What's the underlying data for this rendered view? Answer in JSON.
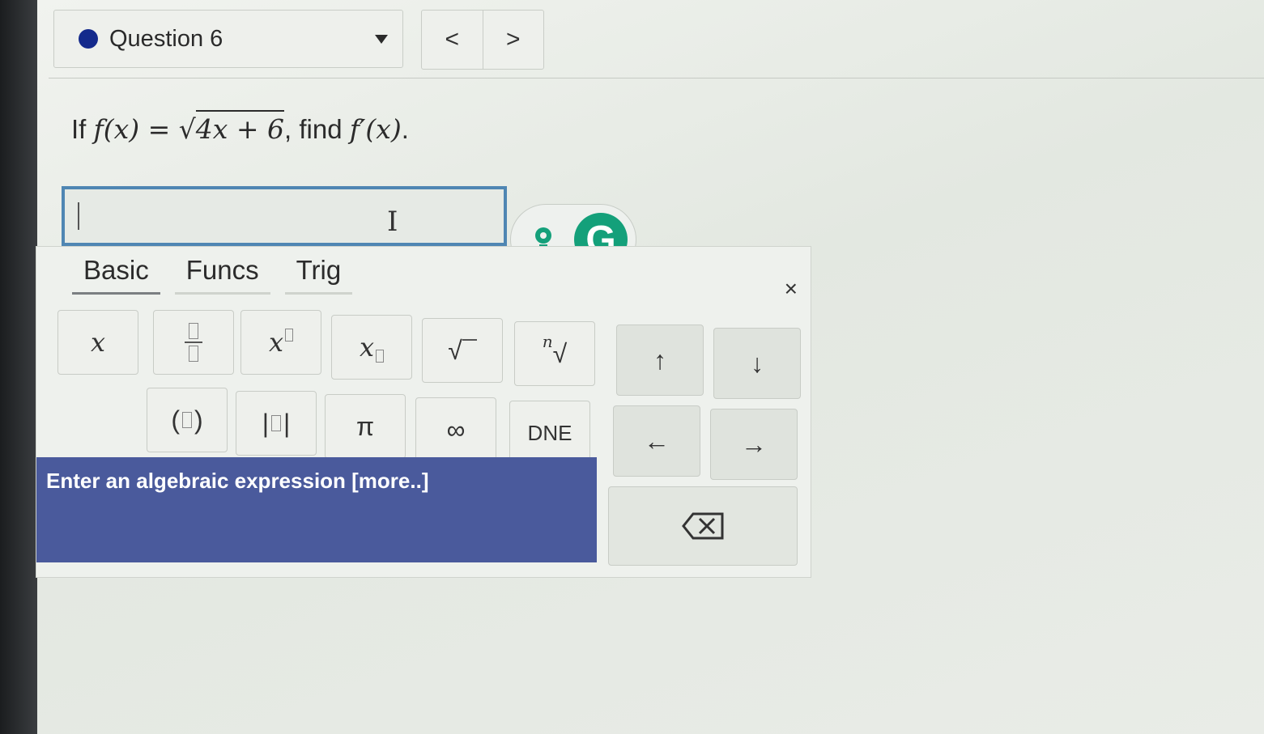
{
  "question": {
    "label": "Question 6",
    "prev": "<",
    "next": ">"
  },
  "prompt": {
    "prefix": "If",
    "func": "f(x) = ",
    "radicand": "4x + 6",
    "middle": ", find",
    "target": "f′(x)",
    "suffix": "."
  },
  "answer": {
    "value": ""
  },
  "palette": {
    "tabs": [
      "Basic",
      "Funcs",
      "Trig"
    ],
    "close": "×",
    "keys": {
      "x": "x",
      "frac": "fraction",
      "power": "x",
      "subscript": "x",
      "sqrt": "√",
      "nthroot_n": "n",
      "nthroot": "√",
      "up": "↑",
      "down": "↓",
      "paren_open": "(",
      "paren_close": ")",
      "abs_open": "|",
      "abs_close": "|",
      "pi": "π",
      "infinity": "∞",
      "dne": "DNE",
      "left": "←",
      "right": "→"
    },
    "status": "Enter an algebraic expression [more..]"
  },
  "colors": {
    "accent": "#142a8c",
    "focus_border": "#4f86b3",
    "status_bar": "#4a5a9c",
    "grammarly": "#14a07a"
  }
}
